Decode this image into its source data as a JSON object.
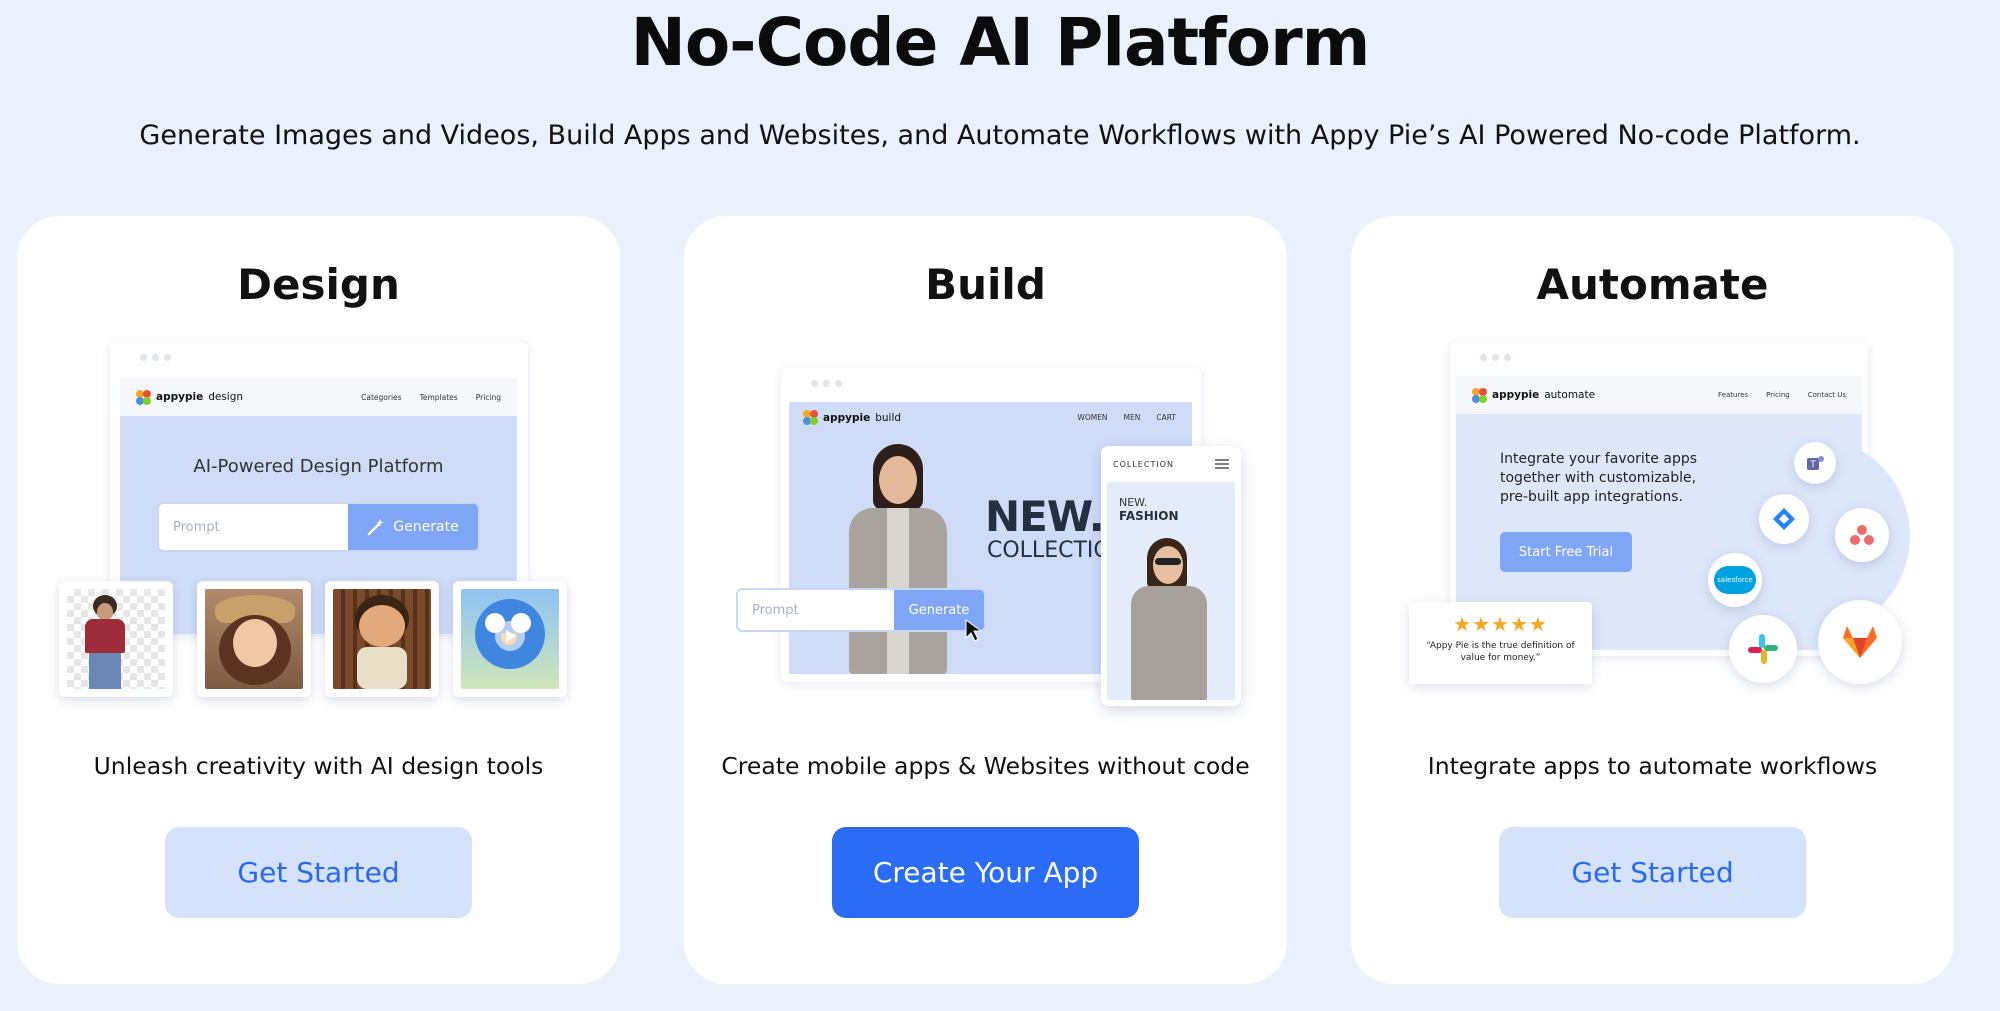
{
  "page": {
    "title": "No-Code AI Platform",
    "subtitle": "Generate Images and Videos, Build Apps and Websites, and Automate Workflows with Appy Pie’s AI Powered No-code Platform."
  },
  "cards": {
    "design": {
      "title": "Design",
      "description": "Unleash creativity with AI design tools",
      "button": "Get Started",
      "mock": {
        "logo": "appypie",
        "logo_suffix": "design",
        "nav": [
          "Categories",
          "Templates",
          "Pricing"
        ],
        "heading": "AI-Powered Design Platform",
        "prompt_placeholder": "Prompt",
        "generate_label": "Generate"
      }
    },
    "build": {
      "title": "Build",
      "description": "Create mobile apps & Websites without code",
      "button": "Create Your App",
      "mock": {
        "logo": "appypie",
        "logo_suffix": "build",
        "nav": [
          "WOMEN",
          "MEN",
          "CART"
        ],
        "hero_big": "NEW.",
        "hero_small": "COLLECTIO",
        "prompt_placeholder": "Prompt",
        "generate_label": "Generate",
        "phone_header": "COLLECTION",
        "phone_new": "NEW.",
        "phone_fashion": "FASHION"
      }
    },
    "automate": {
      "title": "Automate",
      "description": "Integrate apps to automate workflows",
      "button": "Get Started",
      "mock": {
        "logo": "appypie",
        "logo_suffix": "automate",
        "nav": [
          "Features",
          "Pricing",
          "Contact Us"
        ],
        "text": "Integrate your favorite apps together with customizable, pre-built app integrations.",
        "cta": "Start Free Trial",
        "stars": "★★★★★",
        "quote": "“Appy Pie is the true definition of value for money.”",
        "salesforce": "salesforce"
      }
    }
  },
  "colors": {
    "background": "#eaf0fd",
    "primary": "#2a6cf5",
    "light_button": "#d4e2fb",
    "mock_blue": "#cfdcf8",
    "star": "#f5a623"
  },
  "icons": [
    "magic-wand-icon",
    "cursor-icon",
    "play-icon",
    "menu-icon",
    "teams-icon",
    "jira-icon",
    "asana-icon",
    "salesforce-icon",
    "slack-icon",
    "gitlab-icon"
  ]
}
